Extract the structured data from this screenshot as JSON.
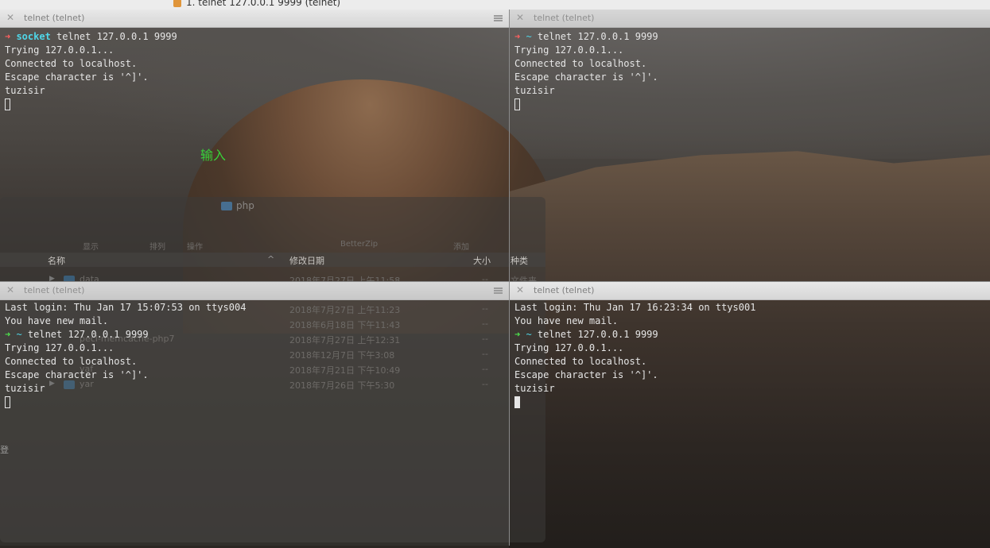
{
  "window": {
    "title": "1. telnet 127.0.0.1 9999 (telnet)"
  },
  "panes": {
    "top_left": {
      "tab_title": "telnet (telnet)",
      "prompt_dir": "socket",
      "command": " telnet 127.0.0.1 9999",
      "lines": [
        "Trying 127.0.0.1...",
        "Connected to localhost.",
        "Escape character is '^]'.",
        "tuzisir"
      ],
      "annotation": "输入"
    },
    "top_right": {
      "tab_title": "telnet (telnet)",
      "prompt_dir": "~",
      "command": " telnet 127.0.0.1 9999",
      "lines": [
        "Trying 127.0.0.1...",
        "Connected to localhost.",
        "Escape character is '^]'.",
        "tuzisir"
      ]
    },
    "bottom_left": {
      "tab_title": "telnet (telnet)",
      "login": "Last login: Thu Jan 17 15:07:53 on ttys004",
      "mail": "You have new mail.",
      "prompt_dir": "~",
      "command": " telnet 127.0.0.1 9999",
      "lines": [
        "Trying 127.0.0.1...",
        "Connected to localhost.",
        "Escape character is '^]'.",
        "tuzisir"
      ]
    },
    "bottom_right": {
      "tab_title": "telnet (telnet)",
      "login": "Last login: Thu Jan 17 16:23:34 on ttys001",
      "mail": "You have new mail.",
      "prompt_dir": "~",
      "command": " telnet 127.0.0.1 9999",
      "lines": [
        "Trying 127.0.0.1...",
        "Connected to localhost.",
        "Escape character is '^]'.",
        "tuzisir"
      ]
    }
  },
  "finder": {
    "title": "php",
    "tools": [
      "显示",
      "排列",
      "操作",
      "BetterZip",
      "添加"
    ],
    "columns": {
      "name": "名称",
      "date": "修改日期",
      "size": "大小",
      "kind": "种类"
    },
    "rows": [
      {
        "name": "data",
        "date": "2018年7月27日 上午11:58",
        "size": "--",
        "kind": "文件夹"
      },
      {
        "name": "",
        "date": "2018年7月27日 上午11:23",
        "size": "--",
        "kind": ""
      },
      {
        "name": "",
        "date": "2018年6月18日 下午11:43",
        "size": "--",
        "kind": ""
      },
      {
        "name": "pecl-memcache-php7",
        "date": "2018年7月27日 上午12:31",
        "size": "--",
        "kind": ""
      },
      {
        "name": "",
        "date": "2018年12月7日 下午3:08",
        "size": "--",
        "kind": ""
      },
      {
        "name": "yaf",
        "date": "2018年7月21日 下午10:49",
        "size": "--",
        "kind": ""
      },
      {
        "name": "yar",
        "date": "2018年7月26日 下午5:30",
        "size": "--",
        "kind": ""
      }
    ],
    "sidebar_glyph": "登"
  },
  "colors": {
    "prompt_arrow_red": "#ff5f5f",
    "prompt_arrow_green": "#4de04d",
    "dir_cyan": "#4fd6e8",
    "annotation_green": "#38d338"
  }
}
